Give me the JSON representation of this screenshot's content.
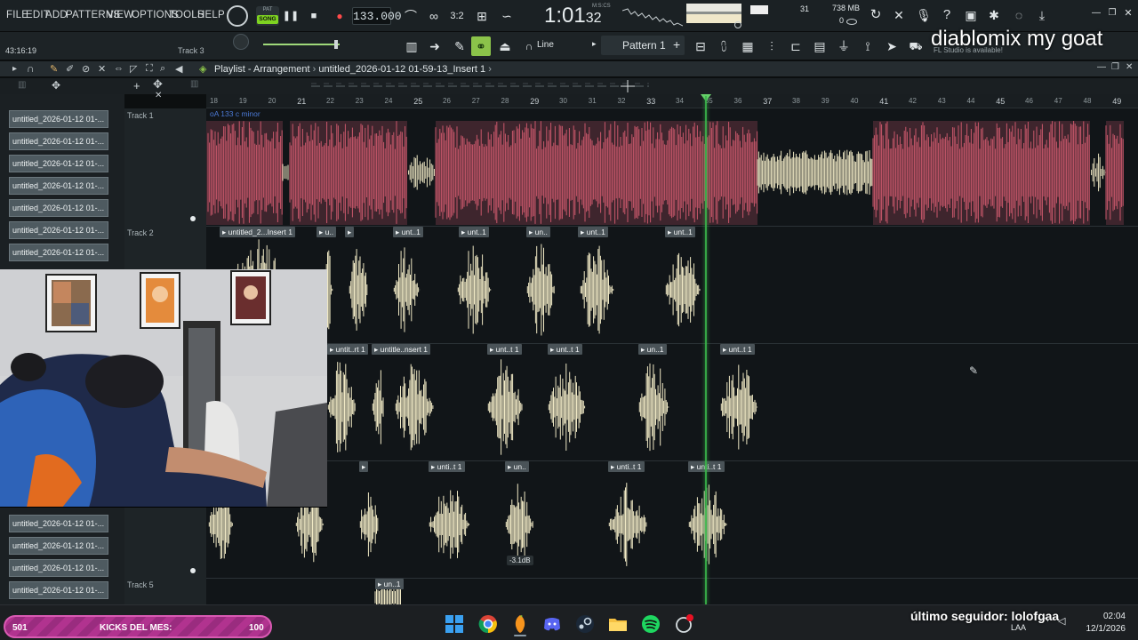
{
  "menu": {
    "items": [
      "FILE",
      "EDIT",
      "ADD",
      "PATTERNS",
      "VIEW",
      "OPTIONS",
      "TOOLS",
      "HELP"
    ]
  },
  "transport": {
    "pat_label": "PAT",
    "song_label": "SONG",
    "tempo": "133.000",
    "time": "1:01",
    "time_frac": "32",
    "time_mode": "M:S:CS",
    "cpu_value": "31",
    "memory": "738 MB",
    "poly": "0"
  },
  "toolbar2": {
    "elapsed": "43:16:19",
    "channel": "Track 3",
    "snap": "Line",
    "pattern": "Pattern 1",
    "hint": "FL Studio is available!"
  },
  "overlay": {
    "stream_title": "diablomix my goat"
  },
  "playlist": {
    "title": "Playlist - Arrangement",
    "clip_name": "untitled_2026-01-12 01-59-13_Insert 1",
    "ruler": [
      "18",
      "19",
      "20",
      "21",
      "22",
      "23",
      "24",
      "25",
      "26",
      "27",
      "28",
      "29",
      "30",
      "31",
      "32",
      "33",
      "34",
      "35",
      "36",
      "37",
      "38",
      "39",
      "40",
      "41",
      "42",
      "43",
      "44",
      "45",
      "46",
      "47",
      "48",
      "49"
    ],
    "tracks": [
      {
        "name": "Track 1"
      },
      {
        "name": "Track 2"
      },
      {
        "name": "Track 5"
      }
    ],
    "track1_info": "oA 133 c minor",
    "volume_label": "-3.1dB",
    "clip_labels_row2": [
      "untitled_2...Insert 1",
      "u..",
      "",
      "unt..1",
      "unt..1",
      "un..",
      "unt..1",
      "unt..1"
    ],
    "clip_labels_row3": [
      "untit..rt 1",
      "untitle..nsert 1",
      "unt..t 1",
      "unt..t 1",
      "un..1",
      "unt..t 1"
    ],
    "clip_labels_row4": [
      "",
      "unti..t 1",
      "un..",
      "unti..t 1",
      "unti..t 1"
    ],
    "clip_labels_row5": [
      "un..1"
    ]
  },
  "browser": {
    "items": [
      "untitled_2026-01-12 01-...",
      "untitled_2026-01-12 01-...",
      "untitled_2026-01-12 01-...",
      "untitled_2026-01-12 01-...",
      "untitled_2026-01-12 01-...",
      "untitled_2026-01-12 01-...",
      "untitled_2026-01-12 01-...",
      "untitled_2026-01-12 01-...",
      "untitled_2026-01-12 01-...",
      "untitled_2026-01-12 01-...",
      "untitled_2026-01-12 01-..."
    ]
  },
  "stream": {
    "kicks_count": "501",
    "kicks_label": "KICKS DEL MES:",
    "kicks_goal": "100",
    "last_follower": "último seguidor: lolofgaa"
  },
  "taskbar": {
    "language": "LAA",
    "clock_time": "02:04",
    "clock_date": "12/1/2026"
  },
  "colors": {
    "clip_red": "#c9576b",
    "clip_cream": "#efe8c4",
    "accent_green": "#7ed321",
    "playhead": "#3ab54a"
  }
}
